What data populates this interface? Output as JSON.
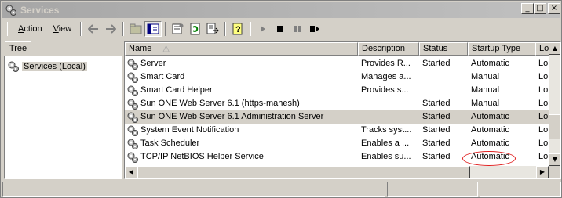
{
  "window": {
    "title": "Services",
    "controls": {
      "minimize": "_",
      "maximize": "□",
      "close": "×"
    }
  },
  "menu": {
    "action": {
      "pre": "",
      "ul": "A",
      "post": "ction"
    },
    "view": {
      "pre": "",
      "ul": "V",
      "post": "iew"
    }
  },
  "toolbar_icons": [
    "back-icon",
    "forward-icon",
    "up-folder-icon",
    "show-hide-tree-icon",
    "properties-icon",
    "refresh-icon",
    "export-list-icon",
    "help-icon",
    "start-service-icon",
    "stop-service-icon",
    "pause-service-icon",
    "restart-service-icon"
  ],
  "tree": {
    "tab_label": "Tree",
    "root_label": "Services (Local)"
  },
  "list": {
    "columns": [
      "Name",
      "Description",
      "Status",
      "Startup Type",
      "Log"
    ],
    "rows": [
      {
        "name": "Server",
        "description": "Provides R...",
        "status": "Started",
        "startup": "Automatic",
        "logon": "Lo"
      },
      {
        "name": "Smart Card",
        "description": "Manages a...",
        "status": "",
        "startup": "Manual",
        "logon": "Lo"
      },
      {
        "name": "Smart Card Helper",
        "description": "Provides s...",
        "status": "",
        "startup": "Manual",
        "logon": "Lo"
      },
      {
        "name": "Sun ONE Web Server 6.1 (https-mahesh)",
        "description": "",
        "status": "Started",
        "startup": "Manual",
        "logon": "Lo"
      },
      {
        "name": "Sun ONE Web Server 6.1 Administration Server",
        "description": "",
        "status": "Started",
        "startup": "Automatic",
        "logon": "Lo",
        "selected": true
      },
      {
        "name": "System Event Notification",
        "description": "Tracks syst...",
        "status": "Started",
        "startup": "Automatic",
        "logon": "Lo"
      },
      {
        "name": "Task Scheduler",
        "description": "Enables a ...",
        "status": "Started",
        "startup": "Automatic",
        "logon": "Lo"
      },
      {
        "name": "TCP/IP NetBIOS Helper Service",
        "description": "Enables su...",
        "status": "Started",
        "startup": "Automatic",
        "logon": "Lo"
      }
    ]
  },
  "annotation": {
    "color": "#e02020",
    "target": "Automatic"
  },
  "colors": {
    "selected_row": "#d4d0c8",
    "face": "#d4d0c8"
  }
}
